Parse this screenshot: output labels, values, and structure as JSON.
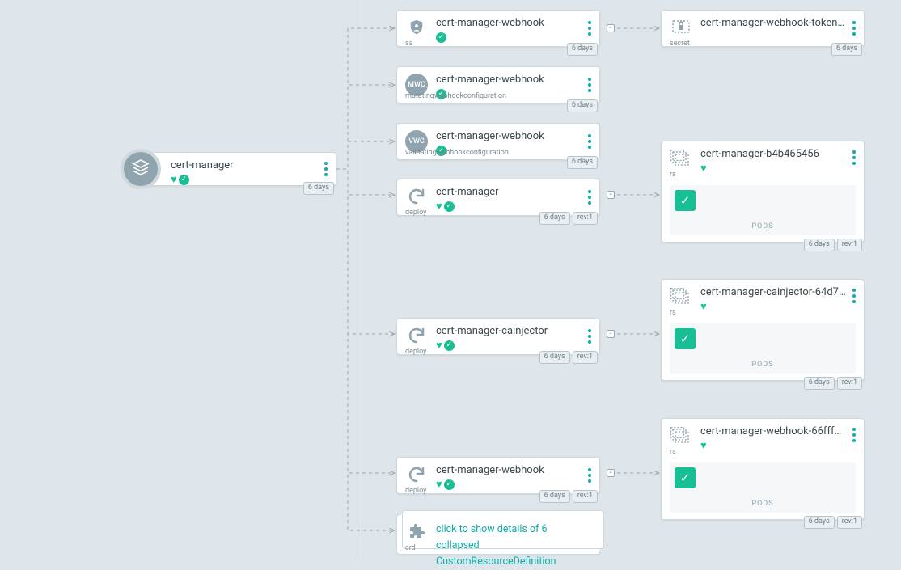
{
  "root": {
    "title": "cert-manager",
    "age": "6 days"
  },
  "col2": [
    {
      "kind": "sa",
      "title": "cert-manager-webhook",
      "age": "6 days",
      "status": [
        "check"
      ]
    },
    {
      "kind": "mutatingwebhookconfiguration",
      "kind_short": "MWC",
      "title": "cert-manager-webhook",
      "age": "6 days",
      "status": [
        "check"
      ]
    },
    {
      "kind": "validatingwebhookconfiguration",
      "kind_short": "VWC",
      "title": "cert-manager-webhook",
      "age": "6 days",
      "status": [
        "check"
      ]
    },
    {
      "kind": "deploy",
      "title": "cert-manager",
      "age": "6 days",
      "rev": "rev:1",
      "status": [
        "heart",
        "check"
      ]
    },
    {
      "kind": "deploy",
      "title": "cert-manager-cainjector",
      "age": "6 days",
      "rev": "rev:1",
      "status": [
        "heart",
        "check"
      ]
    },
    {
      "kind": "deploy",
      "title": "cert-manager-webhook",
      "age": "6 days",
      "rev": "rev:1",
      "status": [
        "heart",
        "check"
      ]
    },
    {
      "kind": "crd",
      "collapsed_line1": "click to show details of 6 collapsed",
      "collapsed_line2": "CustomResourceDefinition"
    }
  ],
  "col3": [
    {
      "kind": "secret",
      "title": "cert-manager-webhook-token…",
      "age": "6 days"
    },
    {
      "kind": "rs",
      "title": "cert-manager-b4b465456",
      "age": "6 days",
      "rev": "rev:1",
      "pods_label": "PODS",
      "status": [
        "heart"
      ]
    },
    {
      "kind": "rs",
      "title": "cert-manager-cainjector-64d7…",
      "age": "6 days",
      "rev": "rev:1",
      "pods_label": "PODS",
      "status": [
        "heart"
      ]
    },
    {
      "kind": "rs",
      "title": "cert-manager-webhook-66fff…",
      "age": "6 days",
      "rev": "rev:1",
      "pods_label": "PODS",
      "status": [
        "heart"
      ]
    }
  ]
}
